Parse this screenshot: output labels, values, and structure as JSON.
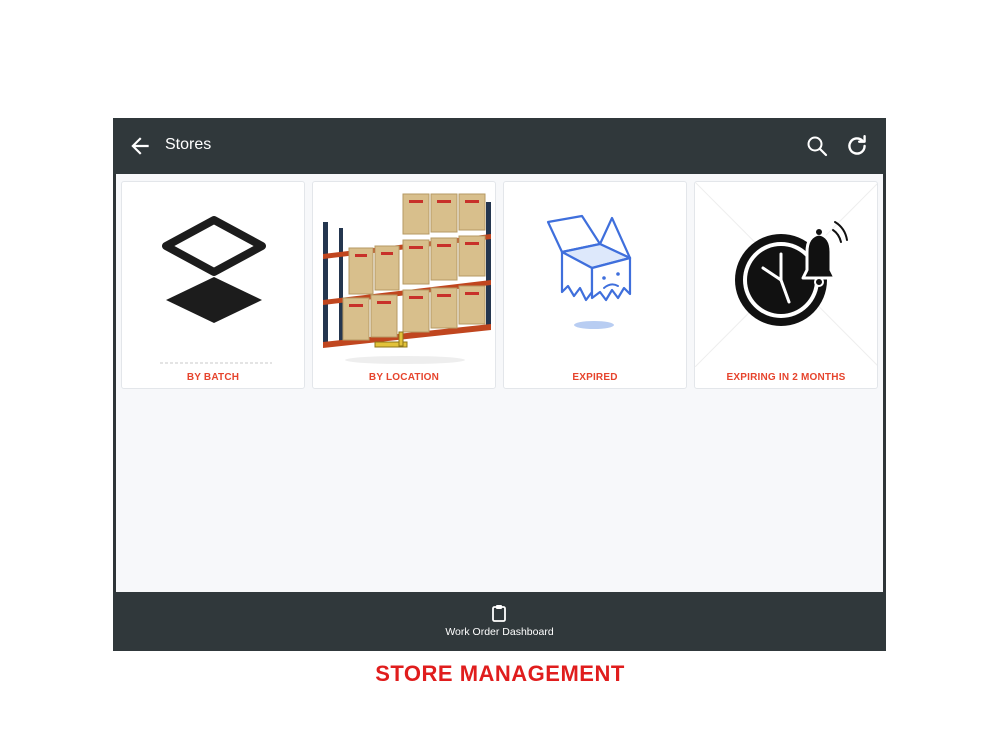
{
  "appbar": {
    "title": "Stores",
    "icons": [
      "back-arrow-icon",
      "search-icon",
      "refresh-icon"
    ]
  },
  "cards": [
    {
      "label": "BY BATCH",
      "icon": "layers-icon"
    },
    {
      "label": "BY LOCATION",
      "icon": "warehouse-racks-image"
    },
    {
      "label": "EXPIRED",
      "icon": "sad-box-icon"
    },
    {
      "label": "EXPIRING IN 2 MONTHS",
      "icon": "clock-alarm-icon"
    }
  ],
  "bottom_nav": {
    "label": "Work Order Dashboard",
    "icon": "clipboard-icon"
  },
  "caption": "STORE MANAGEMENT",
  "colors": {
    "bar": "#30383b",
    "accent": "#e6442d",
    "caption": "#e01d1d",
    "content_bg": "#f7f8fa"
  }
}
